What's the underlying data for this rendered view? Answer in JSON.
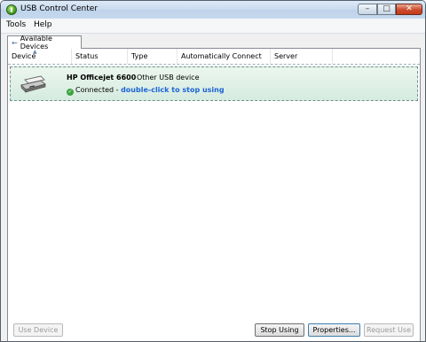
{
  "window": {
    "title": "USB Control Center",
    "minimize_glyph": "–",
    "maximize_glyph": "□",
    "close_glyph": "✕"
  },
  "menu": [
    {
      "label": "Tools"
    },
    {
      "label": "Help"
    }
  ],
  "tabs": [
    {
      "label": "Available Devices",
      "icon": "usb-icon",
      "selected": true
    }
  ],
  "table": {
    "sorted_column": "Device",
    "columns": [
      {
        "label": "Device"
      },
      {
        "label": "Status"
      },
      {
        "label": "Type"
      },
      {
        "label": "Automatically Connect"
      },
      {
        "label": "Server"
      }
    ],
    "rows": [
      {
        "name": "HP Officejet 6600",
        "type": "Other USB device",
        "status": "Connected",
        "separator": " - ",
        "action_text": "double-click to stop using",
        "icon": "printer-icon",
        "selected": true
      }
    ]
  },
  "buttons": {
    "use_device": {
      "label": "Use Device",
      "enabled": false
    },
    "stop_using": {
      "label": "Stop Using",
      "enabled": true
    },
    "properties": {
      "label": "Properties...",
      "enabled": true
    },
    "request_use": {
      "label": "Request Use",
      "enabled": false
    }
  },
  "colors": {
    "selection_row": "#d5ebe0",
    "link": "#1d63d6",
    "status_ok": "#3da340"
  }
}
